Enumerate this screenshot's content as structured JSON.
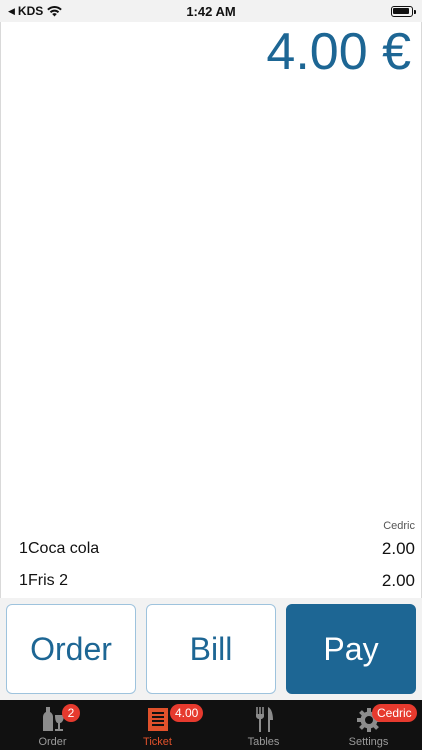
{
  "status_bar": {
    "back_label": "◀",
    "carrier": "KDS",
    "time": "1:42 AM"
  },
  "ticket": {
    "total": "4.00 €",
    "user": "Cedric",
    "lines": [
      {
        "qty": "1",
        "name": "Coca cola",
        "price": "2.00"
      },
      {
        "qty": "1",
        "name": "Fris 2",
        "price": "2.00"
      }
    ]
  },
  "actions": {
    "order": "Order",
    "bill": "Bill",
    "pay": "Pay"
  },
  "tabs": [
    {
      "label": "Order",
      "badge": "2",
      "icon": "bottle-glass-icon"
    },
    {
      "label": "Ticket",
      "badge": "4.00",
      "icon": "receipt-icon",
      "active": true
    },
    {
      "label": "Tables",
      "icon": "fork-knife-icon"
    },
    {
      "label": "Settings",
      "badge": "Cedric",
      "icon": "gear-icon"
    }
  ],
  "colors": {
    "accent": "#1d6694",
    "active_tab": "#e0512b",
    "badge": "#e63a2e"
  }
}
